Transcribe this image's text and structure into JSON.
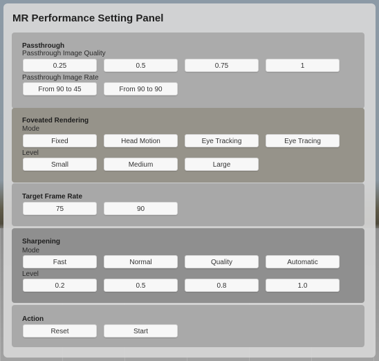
{
  "panel": {
    "title": "MR Performance Setting Panel"
  },
  "passthrough": {
    "title": "Passthrough",
    "quality_label": "Passthrough Image Quality",
    "quality_options": [
      "0.25",
      "0.5",
      "0.75",
      "1"
    ],
    "rate_label": "Passthrough Image Rate",
    "rate_options": [
      "From 90 to 45",
      "From 90 to 90"
    ]
  },
  "foveated": {
    "title": "Foveated Rendering",
    "mode_label": "Mode",
    "mode_options": [
      "Fixed",
      "Head Motion",
      "Eye Tracking",
      "Eye Tracing"
    ],
    "level_label": "Level",
    "level_options": [
      "Small",
      "Medium",
      "Large"
    ]
  },
  "frame_rate": {
    "title": "Target Frame Rate",
    "options": [
      "75",
      "90"
    ]
  },
  "sharpening": {
    "title": "Sharpening",
    "mode_label": "Mode",
    "mode_options": [
      "Fast",
      "Normal",
      "Quality",
      "Automatic"
    ],
    "level_label": "Level",
    "level_options": [
      "0.2",
      "0.5",
      "0.8",
      "1.0"
    ]
  },
  "action": {
    "title": "Action",
    "reset_label": "Reset",
    "start_label": "Start"
  }
}
